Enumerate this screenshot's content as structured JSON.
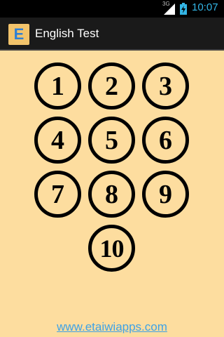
{
  "status_bar": {
    "network": "3G",
    "time": "10:07"
  },
  "action_bar": {
    "icon_letter": "E",
    "title": "English Test"
  },
  "tests": [
    {
      "label": "1"
    },
    {
      "label": "2"
    },
    {
      "label": "3"
    },
    {
      "label": "4"
    },
    {
      "label": "5"
    },
    {
      "label": "6"
    },
    {
      "label": "7"
    },
    {
      "label": "8"
    },
    {
      "label": "9"
    },
    {
      "label": "10"
    }
  ],
  "footer": {
    "link_text": "www.etaiwiapps.com"
  },
  "colors": {
    "background": "#fddd9f",
    "action_bar": "#1a1a1a",
    "status_accent": "#33b5e5",
    "link": "#3ea2e6"
  }
}
